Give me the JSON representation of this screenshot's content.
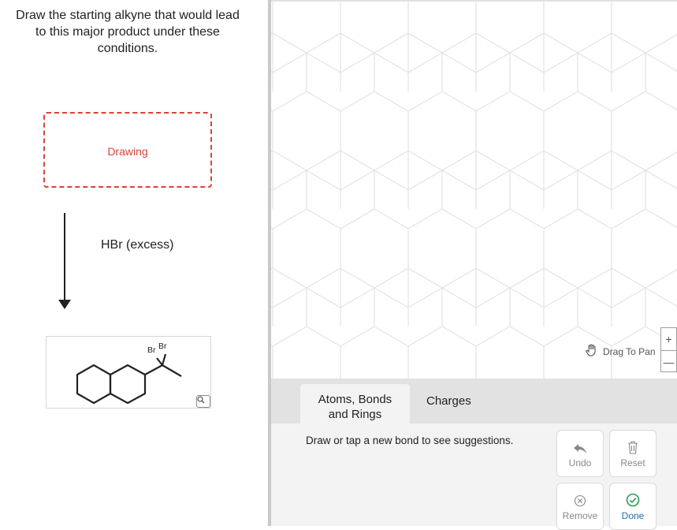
{
  "question": {
    "line1": "Draw the starting alkyne that would lead",
    "line2": "to this major product under these",
    "line3": "conditions."
  },
  "drawing_box": {
    "label": "Drawing"
  },
  "reaction": {
    "reagent": "HBr (excess)"
  },
  "product": {
    "atom_label_1": "Br",
    "atom_label_2": "Br",
    "zoom_icon": "magnifier-icon"
  },
  "canvas": {
    "pan_label": "Drag To Pan",
    "pan_icon": "hand-icon",
    "zoom_in": "+",
    "zoom_out": "—"
  },
  "tabs": {
    "atoms_line1": "Atoms, Bonds",
    "atoms_line2": "and Rings",
    "charges": "Charges"
  },
  "tools": {
    "hint": "Draw or tap a new bond to see suggestions.",
    "undo": "Undo",
    "reset": "Reset",
    "remove": "Remove",
    "done": "Done"
  },
  "colors": {
    "accent_red": "#d9423a",
    "done_blue": "#1f6ea6",
    "panel_gray": "#e2e2e2"
  }
}
